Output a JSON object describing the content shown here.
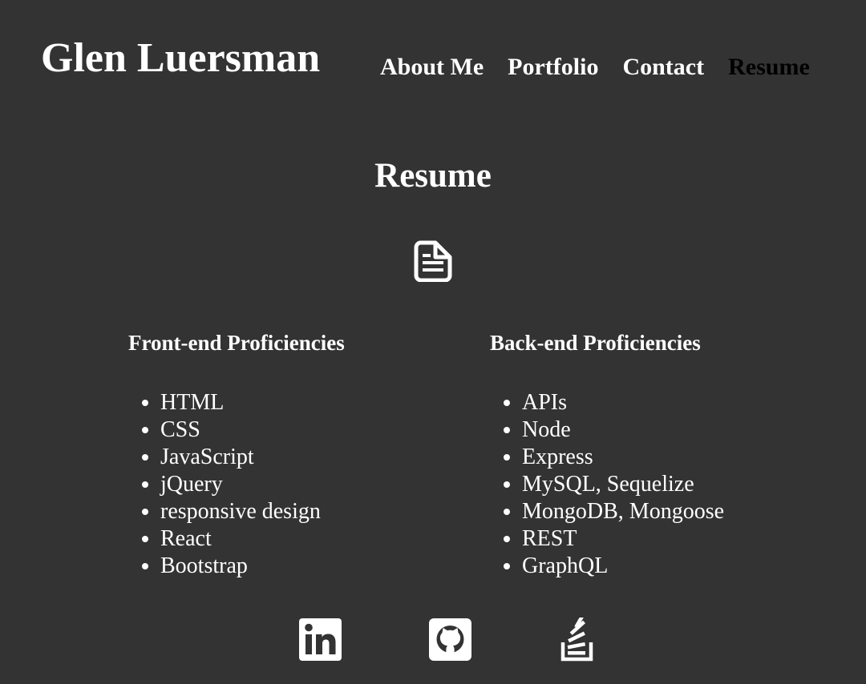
{
  "header": {
    "brand": "Glen Luersman",
    "nav": [
      {
        "label": "About Me",
        "active": false
      },
      {
        "label": "Portfolio",
        "active": false
      },
      {
        "label": "Contact",
        "active": false
      },
      {
        "label": "Resume",
        "active": true
      }
    ]
  },
  "main": {
    "title": "Resume",
    "resume_icon": "document-icon",
    "frontend": {
      "heading": "Front-end Proficiencies",
      "items": [
        "HTML",
        "CSS",
        "JavaScript",
        "jQuery",
        "responsive design",
        "React",
        "Bootstrap"
      ]
    },
    "backend": {
      "heading": "Back-end Proficiencies",
      "items": [
        "APIs",
        "Node",
        "Express",
        "MySQL, Sequelize",
        "MongoDB, Mongoose",
        "REST",
        "GraphQL"
      ]
    }
  },
  "footer": {
    "social": [
      {
        "icon": "linkedin-icon"
      },
      {
        "icon": "github-icon"
      },
      {
        "icon": "stackoverflow-icon"
      }
    ]
  },
  "colors": {
    "background": "#333333",
    "text": "#ffffff",
    "active_nav": "#000000"
  }
}
